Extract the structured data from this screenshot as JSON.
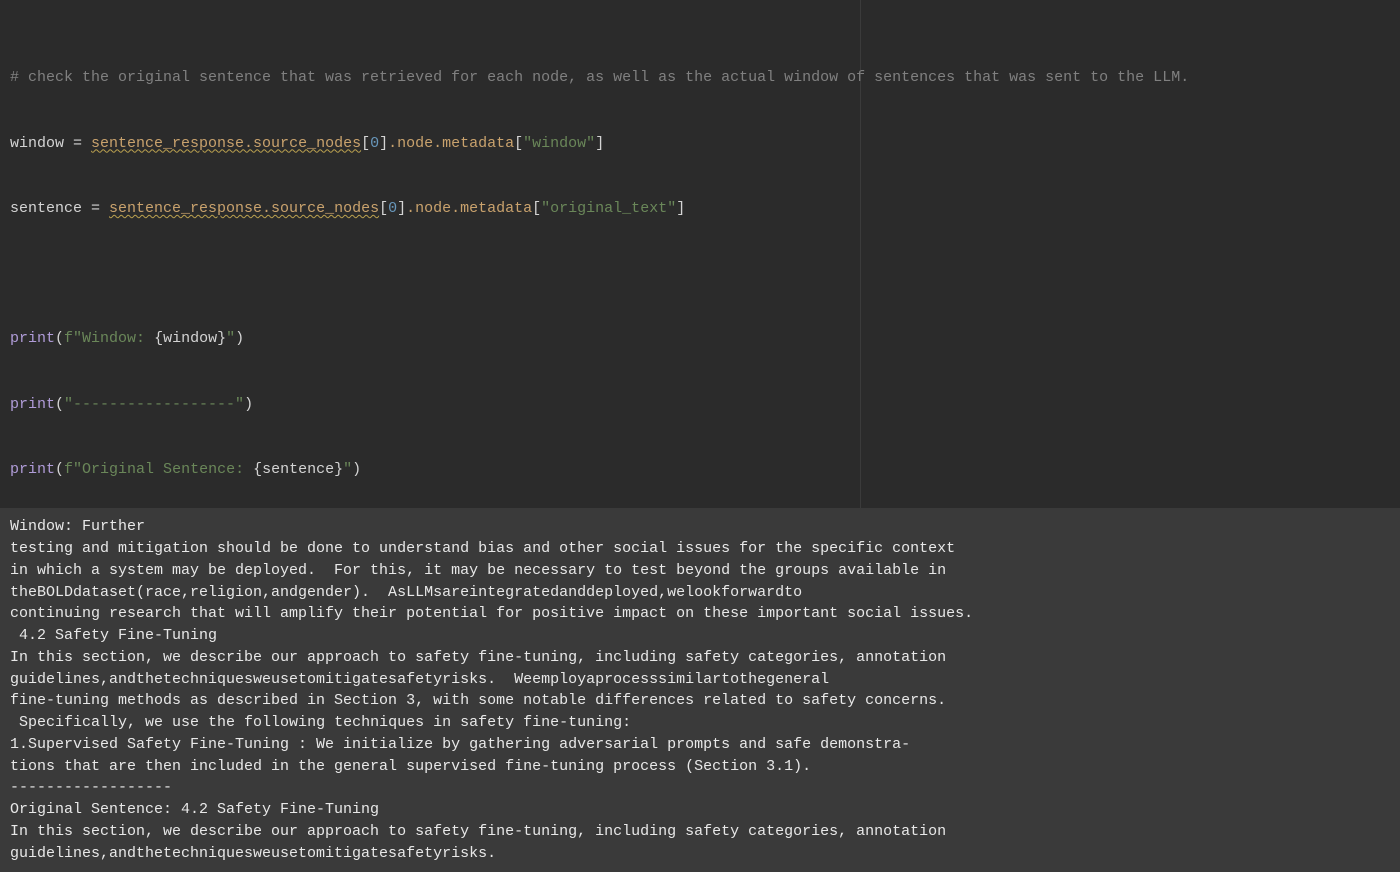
{
  "code": {
    "comment": "# check the original sentence that was retrieved for each node, as well as the actual window of sentences that was sent to the LLM.",
    "line1_lhs": "window",
    "line1_eq": " = ",
    "line1_chain": "sentence_response.source_nodes",
    "line1_idx_open": "[",
    "line1_idx": "0",
    "line1_idx_close": "]",
    "line1_tail": ".node.metadata",
    "line1_br_open": "[",
    "line1_key": "\"window\"",
    "line1_br_close": "]",
    "line2_lhs": "sentence",
    "line2_eq": " = ",
    "line2_chain": "sentence_response.source_nodes",
    "line2_idx_open": "[",
    "line2_idx": "0",
    "line2_idx_close": "]",
    "line2_tail": ".node.metadata",
    "line2_br_open": "[",
    "line2_key": "\"original_text\"",
    "line2_br_close": "]",
    "print_fn": "print",
    "p1_open": "(",
    "p1_f": "f",
    "p1_str_a": "\"Window: ",
    "p1_brace_open": "{",
    "p1_var": "window",
    "p1_brace_close": "}",
    "p1_str_b": "\"",
    "p1_close": ")",
    "p2_open": "(",
    "p2_str": "\"------------------\"",
    "p2_close": ")",
    "p3_open": "(",
    "p3_f": "f",
    "p3_str_a": "\"Original Sentence: ",
    "p3_brace_open": "{",
    "p3_var": "sentence",
    "p3_brace_close": "}",
    "p3_str_b": "\"",
    "p3_close": ")"
  },
  "output": {
    "text": "Window: Further\ntesting and mitigation should be done to understand bias and other social issues for the specific context\nin which a system may be deployed.  For this, it may be necessary to test beyond the groups available in\ntheBOLDdataset(race,religion,andgender).  AsLLMsareintegratedanddeployed,welookforwardto\ncontinuing research that will amplify their potential for positive impact on these important social issues.\n 4.2 Safety Fine-Tuning\nIn this section, we describe our approach to safety fine-tuning, including safety categories, annotation\nguidelines,andthetechniquesweusetomitigatesafetyrisks.  Weemployaprocesssimilartothegeneral\nfine-tuning methods as described in Section 3, with some notable differences related to safety concerns.\n Specifically, we use the following techniques in safety fine-tuning:\n1.Supervised Safety Fine-Tuning : We initialize by gathering adversarial prompts and safe demonstra-\ntions that are then included in the general supervised fine-tuning process (Section 3.1). \n------------------\nOriginal Sentence: 4.2 Safety Fine-Tuning\nIn this section, we describe our approach to safety fine-tuning, including safety categories, annotation\nguidelines,andthetechniquesweusetomitigatesafetyrisks. "
  }
}
